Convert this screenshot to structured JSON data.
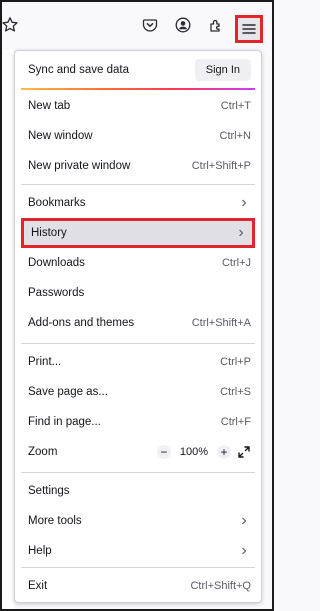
{
  "sync": {
    "label": "Sync and save data",
    "signin_label": "Sign In"
  },
  "items": {
    "new_tab": {
      "label": "New tab",
      "shortcut": "Ctrl+T"
    },
    "new_window": {
      "label": "New window",
      "shortcut": "Ctrl+N"
    },
    "new_private_window": {
      "label": "New private window",
      "shortcut": "Ctrl+Shift+P"
    },
    "bookmarks": {
      "label": "Bookmarks"
    },
    "history": {
      "label": "History"
    },
    "downloads": {
      "label": "Downloads",
      "shortcut": "Ctrl+J"
    },
    "passwords": {
      "label": "Passwords"
    },
    "addons": {
      "label": "Add-ons and themes",
      "shortcut": "Ctrl+Shift+A"
    },
    "print": {
      "label": "Print...",
      "shortcut": "Ctrl+P"
    },
    "save_page": {
      "label": "Save page as...",
      "shortcut": "Ctrl+S"
    },
    "find": {
      "label": "Find in page...",
      "shortcut": "Ctrl+F"
    },
    "zoom": {
      "label": "Zoom",
      "level": "100%"
    },
    "settings": {
      "label": "Settings"
    },
    "more_tools": {
      "label": "More tools"
    },
    "help": {
      "label": "Help"
    },
    "exit": {
      "label": "Exit",
      "shortcut": "Ctrl+Shift+Q"
    }
  },
  "icons": {
    "toolbar": [
      "star-icon",
      "pocket-icon",
      "account-icon",
      "extensions-icon",
      "hamburger-menu-icon"
    ],
    "zoom": [
      "zoom-out-icon",
      "zoom-in-icon",
      "fullscreen-icon"
    ],
    "submenu": "chevron-right-icon"
  },
  "colors": {
    "highlight_border": "#e0252d",
    "hover_bg": "#e0e0e6"
  }
}
